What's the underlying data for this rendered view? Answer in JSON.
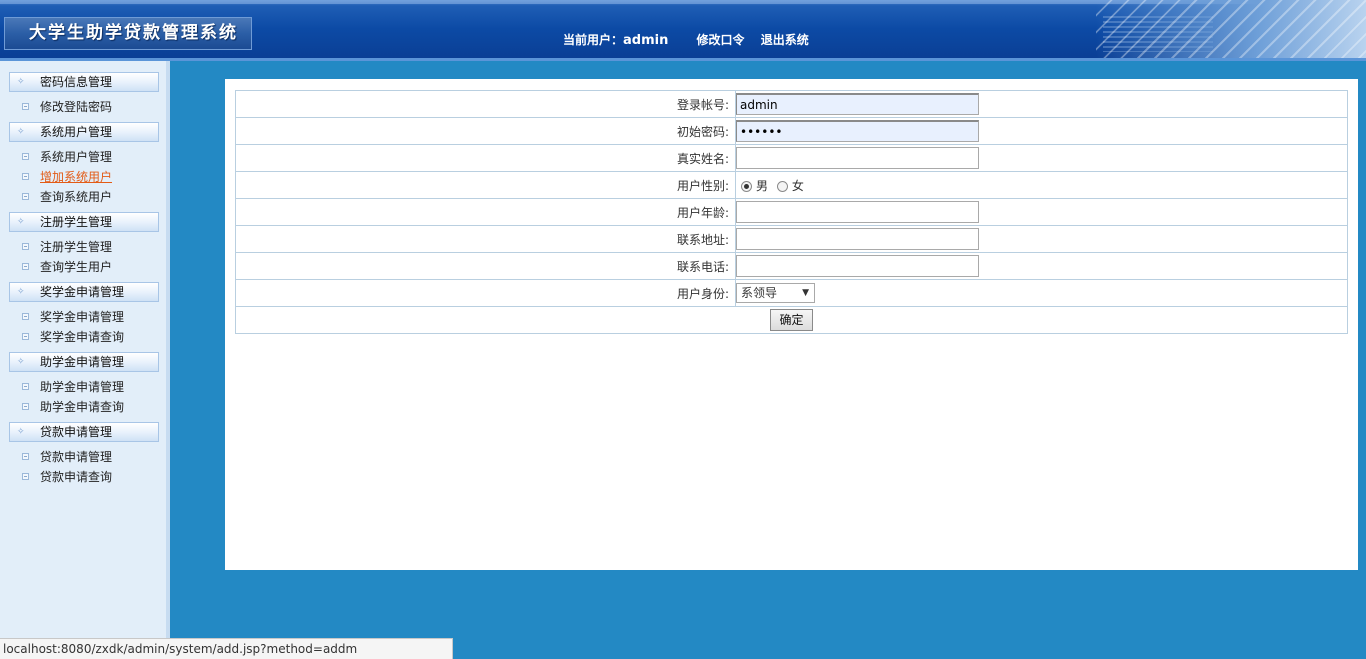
{
  "header": {
    "system_title": "大学生助学贷款管理系统",
    "current_user_label": "当前用户：",
    "current_user": "admin",
    "change_password": "修改口令",
    "logout": "退出系统"
  },
  "sidebar": {
    "groups": [
      {
        "title": "密码信息管理",
        "items": [
          "修改登陆密码"
        ]
      },
      {
        "title": "系统用户管理",
        "items": [
          "系统用户管理",
          "增加系统用户",
          "查询系统用户"
        ]
      },
      {
        "title": "注册学生管理",
        "items": [
          "注册学生管理",
          "查询学生用户"
        ]
      },
      {
        "title": "奖学金申请管理",
        "items": [
          "奖学金申请管理",
          "奖学金申请查询"
        ]
      },
      {
        "title": "助学金申请管理",
        "items": [
          "助学金申请管理",
          "助学金申请查询"
        ]
      },
      {
        "title": "贷款申请管理",
        "items": [
          "贷款申请管理",
          "贷款申请查询"
        ]
      }
    ],
    "active_item": "增加系统用户"
  },
  "form": {
    "login_account_label": "登录帐号:",
    "login_account_value": "admin",
    "initial_password_label": "初始密码:",
    "initial_password_value": "••••••",
    "real_name_label": "真实姓名:",
    "real_name_value": "",
    "gender_label": "用户性别:",
    "gender_male": "男",
    "gender_female": "女",
    "gender_selected": "男",
    "age_label": "用户年龄:",
    "age_value": "",
    "address_label": "联系地址:",
    "address_value": "",
    "phone_label": "联系电话:",
    "phone_value": "",
    "role_label": "用户身份:",
    "role_selected": "系领导",
    "submit_label": "确定"
  },
  "statusbar": {
    "url": "localhost:8080/zxdk/admin/system/add.jsp?method=addm"
  },
  "colors": {
    "page_bg": "#2389c4",
    "header_bg": "#0c4aa5",
    "sidebar_bg": "#e2eef9",
    "active_link": "#e35b16"
  }
}
